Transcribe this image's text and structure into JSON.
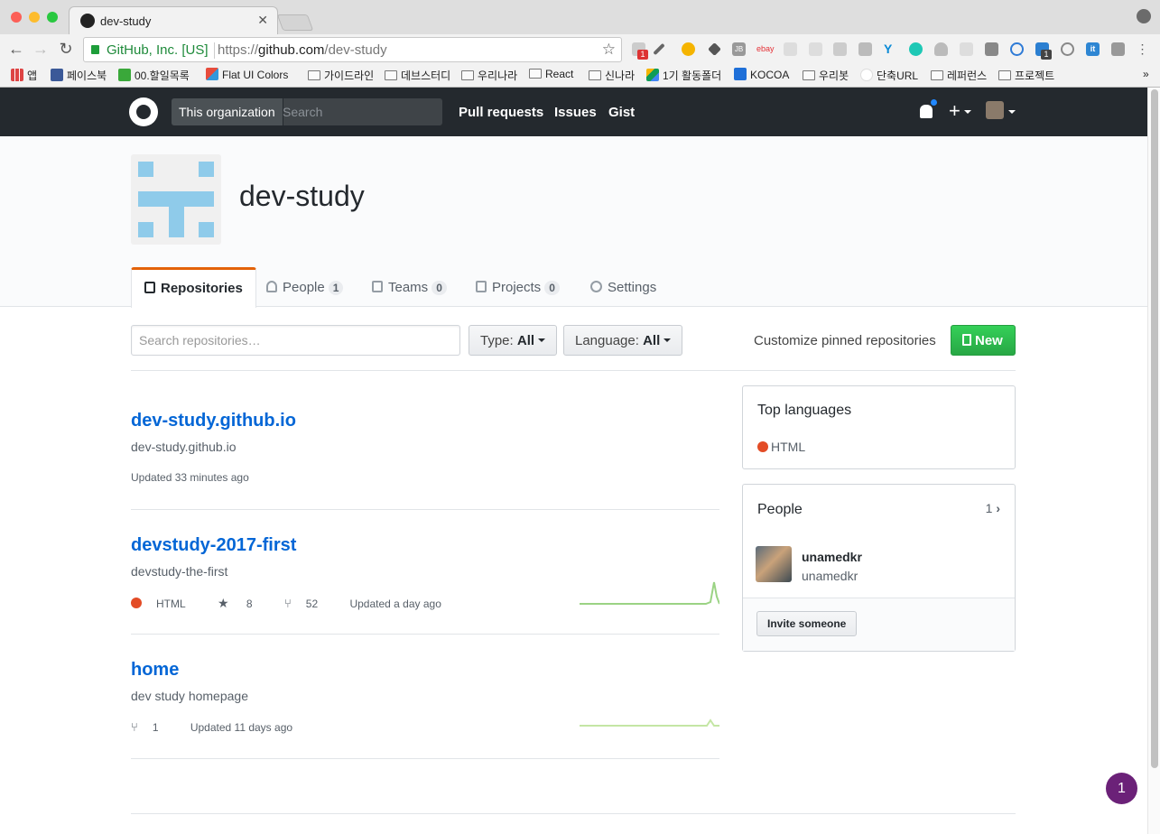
{
  "browser": {
    "tab_title": "dev-study",
    "secure_label": "GitHub, Inc. [US]",
    "url_prefix": "https://",
    "url_host": "github.com",
    "url_path": "/dev-study",
    "extension_badges": [
      "1",
      "1"
    ],
    "extension_text": [
      "JB",
      "ebay",
      "it"
    ],
    "bookmarks": [
      "앱",
      "페이스북",
      "00.할일목록",
      "Flat UI Colors",
      "가이드라인",
      "데브스터디",
      "우리나라",
      "React",
      "신나라",
      "1기 활동폴더",
      "KOCOA",
      "우리봇",
      "단축URL",
      "레퍼런스",
      "프로젝트"
    ],
    "bookmarks_more": "»"
  },
  "header": {
    "scope_label": "This organization",
    "search_placeholder": "Search",
    "nav": [
      "Pull requests",
      "Issues",
      "Gist"
    ],
    "plus_label": "+"
  },
  "org": {
    "name": "dev-study",
    "tabs": [
      {
        "label": "Repositories"
      },
      {
        "label": "People",
        "count": "1"
      },
      {
        "label": "Teams",
        "count": "0"
      },
      {
        "label": "Projects",
        "count": "0"
      },
      {
        "label": "Settings"
      }
    ]
  },
  "filters": {
    "search_placeholder": "Search repositories…",
    "type_prefix": "Type:",
    "type_value": "All",
    "language_prefix": "Language:",
    "language_value": "All",
    "pinned_label": "Customize pinned repositories",
    "new_label": "New"
  },
  "repos": [
    {
      "name": "dev-study.github.io",
      "description": "dev-study.github.io",
      "updated": "Updated 33 minutes ago"
    },
    {
      "name": "devstudy-2017-first",
      "description": "devstudy-the-first",
      "language": "HTML",
      "stars": "8",
      "forks": "52",
      "updated": "Updated a day ago"
    },
    {
      "name": "home",
      "description": "dev study homepage",
      "forks": "1",
      "updated": "Updated 11 days ago"
    }
  ],
  "sidebar": {
    "top_languages_title": "Top languages",
    "language": "HTML",
    "people_title": "People",
    "people_count": "1",
    "person_name": "unamedkr",
    "person_login": "unamedkr",
    "invite_label": "Invite someone"
  },
  "chat_bubble_count": "1",
  "colors": {
    "html_language": "#e34c26",
    "accent_link": "#0366d6",
    "new_button": "#28a745",
    "tab_underline": "#e36209",
    "spark": "#9bd384"
  }
}
